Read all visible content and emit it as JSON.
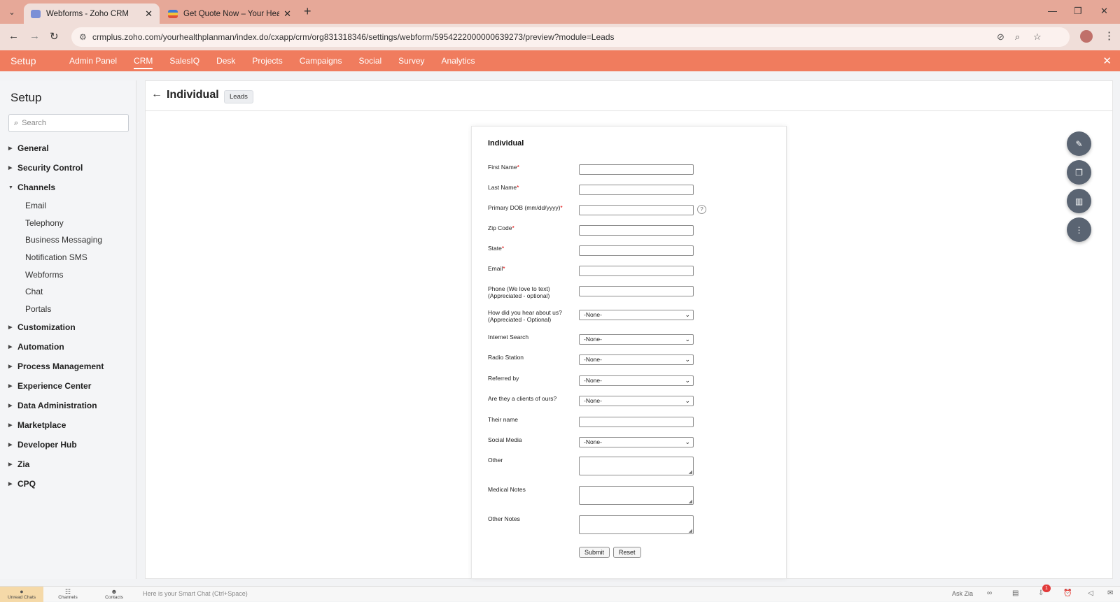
{
  "browser": {
    "tabs": [
      {
        "title": "Webforms - Zoho CRM",
        "active": true
      },
      {
        "title": "Get Quote Now – Your Health Plan Man",
        "active": false
      }
    ],
    "url": "crmplus.zoho.com/yourhealthplanman/index.do/cxapp/crm/org831318346/settings/webform/5954222000000639273/preview?module=Leads"
  },
  "appnav": {
    "title": "Setup",
    "links": [
      "Admin Panel",
      "CRM",
      "SalesIQ",
      "Desk",
      "Projects",
      "Campaigns",
      "Social",
      "Survey",
      "Analytics"
    ],
    "active_link": "CRM"
  },
  "sidebar": {
    "title": "Setup",
    "search_placeholder": "Search",
    "groups_before": [
      "General",
      "Security Control"
    ],
    "expanded_group": "Channels",
    "channel_items": [
      "Email",
      "Telephony",
      "Business Messaging",
      "Notification SMS",
      "Webforms",
      "Chat",
      "Portals"
    ],
    "groups_after": [
      "Customization",
      "Automation",
      "Process Management",
      "Experience Center",
      "Data Administration",
      "Marketplace",
      "Developer Hub",
      "Zia",
      "CPQ"
    ]
  },
  "header": {
    "title": "Individual",
    "badge": "Leads"
  },
  "form": {
    "title": "Individual",
    "fields": [
      {
        "label": "First Name",
        "required": true,
        "type": "text"
      },
      {
        "label": "Last Name",
        "required": true,
        "type": "text"
      },
      {
        "label": "Primary DOB (mm/dd/yyyy)",
        "required": true,
        "type": "text",
        "help": "?"
      },
      {
        "label": "Zip Code",
        "required": true,
        "type": "text"
      },
      {
        "label": "State",
        "required": true,
        "type": "text"
      },
      {
        "label": "Email",
        "required": true,
        "type": "text"
      },
      {
        "label": "Phone (We love to text) (Appreciated - optional)",
        "required": false,
        "type": "text"
      },
      {
        "label": "How did you hear about us? (Appreciated - Optional)",
        "required": false,
        "type": "select",
        "value": "-None-"
      },
      {
        "label": "Internet Search",
        "required": false,
        "type": "select",
        "value": "-None-"
      },
      {
        "label": "Radio Station",
        "required": false,
        "type": "select",
        "value": "-None-"
      },
      {
        "label": "Referred by",
        "required": false,
        "type": "select",
        "value": "-None-"
      },
      {
        "label": "Are they a clients of ours?",
        "required": false,
        "type": "select",
        "value": "-None-"
      },
      {
        "label": "Their name",
        "required": false,
        "type": "text"
      },
      {
        "label": "Social Media",
        "required": false,
        "type": "select",
        "value": "-None-"
      },
      {
        "label": "Other",
        "required": false,
        "type": "textarea"
      },
      {
        "label": "Medical Notes",
        "required": false,
        "type": "textarea"
      },
      {
        "label": "Other Notes",
        "required": false,
        "type": "textarea"
      }
    ],
    "submit_label": "Submit",
    "reset_label": "Reset"
  },
  "fab_icons": [
    "pencil-icon",
    "copy-icon",
    "chart-icon",
    "more-vertical-icon"
  ],
  "bottombar": {
    "items": [
      "Unread Chats",
      "Channels",
      "Contacts"
    ],
    "smartchat_placeholder": "Here is your Smart Chat (Ctrl+Space)",
    "ask_zia": "Ask Zia",
    "notification_count": "1"
  },
  "colors": {
    "brand": "#f07c5e",
    "tabbar": "#e6a898",
    "fab": "#5a6472"
  }
}
